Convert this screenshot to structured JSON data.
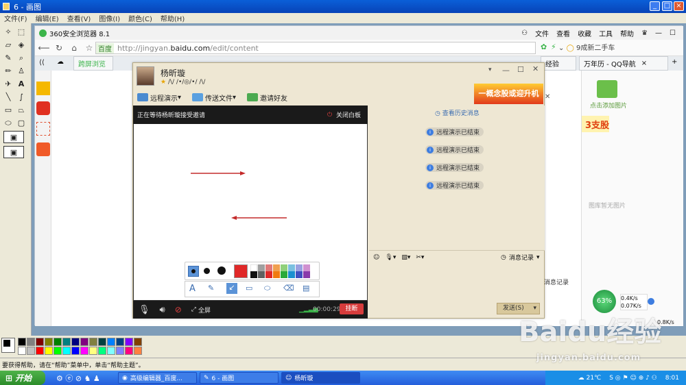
{
  "paint": {
    "title": "6 - 画图",
    "menu": [
      "文件(F)",
      "编辑(E)",
      "查看(V)",
      "图像(I)",
      "颜色(C)",
      "帮助(H)"
    ],
    "status": "要获得帮助，请在“帮助”菜单中，单击“帮助主题”。",
    "palette_colors": [
      "#000000",
      "#808080",
      "#800000",
      "#808000",
      "#008000",
      "#008080",
      "#000080",
      "#800080",
      "#808040",
      "#004040",
      "#0080ff",
      "#004080",
      "#8000ff",
      "#804000",
      "#ffffff",
      "#c0c0c0",
      "#ff0000",
      "#ffff00",
      "#00ff00",
      "#00ffff",
      "#0000ff",
      "#ff00ff",
      "#ffff80",
      "#00ff80",
      "#80ffff",
      "#8080ff",
      "#ff0080",
      "#ff8040"
    ]
  },
  "browser": {
    "title": "360安全浏览器 8.1",
    "menu": [
      "文件",
      "查看",
      "收藏",
      "工具",
      "帮助"
    ],
    "search_engine": "百度",
    "url_prefix": "http://jingyan.",
    "url_domain": "baidu.com",
    "url_path": "/edit/content",
    "right_search": "9成新二手车",
    "tabs": [
      "跨屏浏览",
      "经验",
      "万年历 - QQ导航"
    ],
    "sidebar_right": {
      "add_image": "点击添加图片",
      "empty": "图库暂无图片",
      "msg_log": "消息记录"
    },
    "speed": {
      "percent": "63%",
      "up": "0.4K/s",
      "down": "0.07K/s",
      "extra": "0.8K/s"
    },
    "ad_right": "3支股"
  },
  "qq": {
    "name": "杨昕璇",
    "signature": "/\\/ /•/◎/•/ /\\/",
    "tools": [
      "远程演示",
      "传送文件",
      "邀请好友"
    ],
    "whiteboard_status": "正在等待杨昕璇接受邀请",
    "close_board": "关闭白板",
    "history": "查看历史消息",
    "notices": [
      "远程演示已结束",
      "远程演示已结束",
      "远程演示已结束",
      "远程演示已结束"
    ],
    "fullscreen": "全屏",
    "timer": "00:00:29",
    "hangup": "挂断",
    "msg_log": "消息记录",
    "send": "发送(S)",
    "ad": "一概念股或迎升机"
  },
  "taskbar": {
    "start": "开始",
    "tasks": [
      "高级编辑器_百度...",
      "6 - 画图",
      "杨昕璇"
    ],
    "weather": "21℃",
    "clock": "8:01"
  },
  "watermark": {
    "main": "Baidu经验",
    "sub": "jingyan.baidu.com"
  }
}
